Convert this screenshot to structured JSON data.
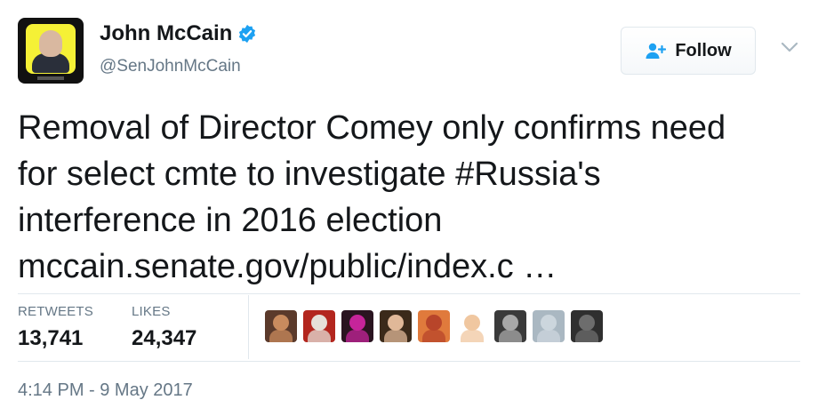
{
  "user": {
    "name": "John McCain",
    "handle": "@SenJohnMcCain",
    "verified": true
  },
  "follow_button": {
    "label": "Follow"
  },
  "tweet": {
    "lines": [
      "Removal of Director Comey only confirms need",
      "for select cmte to investigate #Russia's",
      "interference in 2016 election",
      "mccain.senate.gov/public/index.c  …"
    ]
  },
  "stats": {
    "retweets_label": "RETWEETS",
    "retweets_count": "13,741",
    "likes_label": "LIKES",
    "likes_count": "24,347"
  },
  "likers": [
    {
      "name": "liker-avatar-1",
      "colors": [
        "#c98b5e",
        "#5b3a2b"
      ]
    },
    {
      "name": "liker-avatar-2",
      "colors": [
        "#e6e0d8",
        "#b3261e"
      ]
    },
    {
      "name": "liker-avatar-3",
      "colors": [
        "#c6249a",
        "#2a1420"
      ]
    },
    {
      "name": "liker-avatar-4",
      "colors": [
        "#e0b898",
        "#3b2a1a"
      ]
    },
    {
      "name": "liker-avatar-5",
      "colors": [
        "#b8452a",
        "#e07a3c"
      ]
    },
    {
      "name": "liker-avatar-6",
      "colors": [
        "#f0c7a0",
        "#ffffff"
      ]
    },
    {
      "name": "liker-avatar-7",
      "colors": [
        "#a8a8a8",
        "#3a3a3a"
      ]
    },
    {
      "name": "liker-avatar-8",
      "colors": [
        "#ccd6dd",
        "#aab8c2"
      ]
    },
    {
      "name": "liker-avatar-9",
      "colors": [
        "#6d6d6d",
        "#2f2f2f"
      ]
    }
  ],
  "timestamp": "4:14 PM - 9 May 2017",
  "colors": {
    "text": "#14171a",
    "muted": "#657786",
    "verified_blue": "#1da1f2",
    "border": "#e1e8ed"
  }
}
